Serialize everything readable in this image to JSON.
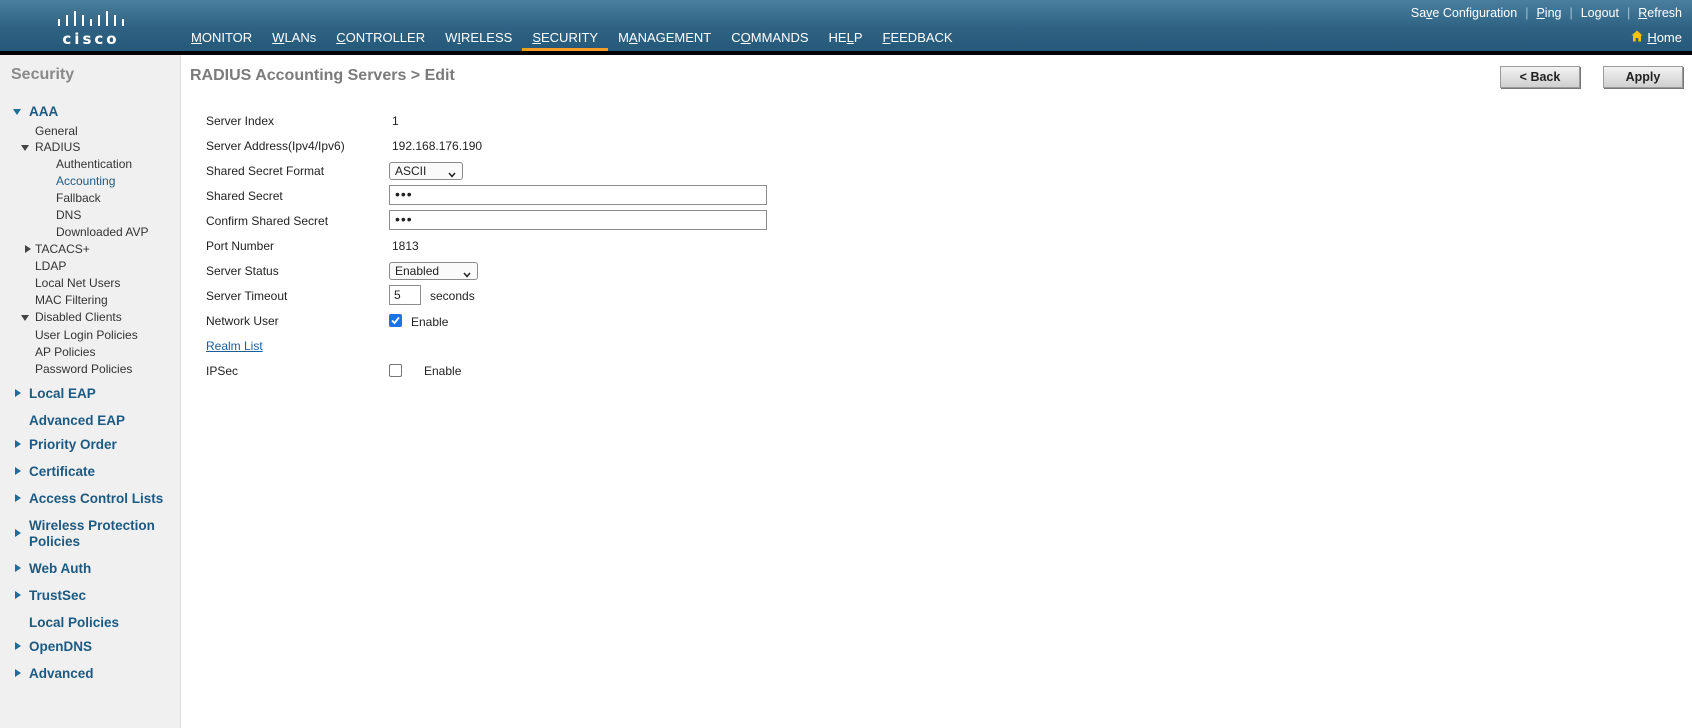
{
  "brand": {
    "logo_text": "cisco"
  },
  "header": {
    "nav": [
      {
        "label": "MONITOR",
        "key": "M",
        "rest": "ONITOR",
        "active": false
      },
      {
        "label": "WLANs",
        "key": "W",
        "rest": "LANs",
        "active": false
      },
      {
        "label": "CONTROLLER",
        "key": "C",
        "rest": "ONTROLLER",
        "active": false
      },
      {
        "label": "WIRELESS",
        "key": "I",
        "pre": "W",
        "rest": "RELESS",
        "active": false
      },
      {
        "label": "SECURITY",
        "key": "S",
        "rest": "ECURITY",
        "active": true
      },
      {
        "label": "MANAGEMENT",
        "key": "A",
        "pre": "M",
        "rest": "NAGEMENT",
        "active": false
      },
      {
        "label": "COMMANDS",
        "key": "O",
        "pre": "C",
        "rest": "MMANDS",
        "active": false
      },
      {
        "label": "HELP",
        "key": "L",
        "pre": "HE",
        "rest": "P",
        "active": false
      },
      {
        "label": "FEEDBACK",
        "key": "F",
        "rest": "EEDBACK",
        "active": false
      }
    ],
    "links": {
      "save_pre": "Sa",
      "save_key": "v",
      "save_rest": "e Configuration",
      "ping_key": "P",
      "ping_rest": "ing",
      "logout_pre": "Logout",
      "refresh_key": "R",
      "refresh_rest": "efresh",
      "separator": "|"
    },
    "home_key": "H",
    "home_rest": "ome"
  },
  "sidebar": {
    "title": "Security",
    "aaa": "AAA",
    "general": "General",
    "radius": "RADIUS",
    "authentication": "Authentication",
    "accounting": "Accounting",
    "fallback": "Fallback",
    "dns": "DNS",
    "downloaded_avp": "Downloaded AVP",
    "tacacs": "TACACS+",
    "ldap": "LDAP",
    "local_net_users": "Local Net Users",
    "mac_filtering": "MAC Filtering",
    "disabled_clients": "Disabled Clients",
    "user_login_policies": "User Login Policies",
    "ap_policies": "AP Policies",
    "password_policies": "Password Policies",
    "local_eap": "Local EAP",
    "advanced_eap": "Advanced EAP",
    "priority_order": "Priority Order",
    "certificate": "Certificate",
    "acl": "Access Control Lists",
    "wpp_line1": "Wireless Protection",
    "wpp_line2": "Policies",
    "web_auth": "Web Auth",
    "trustsec": "TrustSec",
    "local_policies": "Local Policies",
    "opendns": "OpenDNS",
    "advanced": "Advanced"
  },
  "main": {
    "title": "RADIUS Accounting Servers > Edit",
    "back_button": "< Back",
    "apply_button": "Apply",
    "fields": {
      "server_index_label": "Server Index",
      "server_index_value": "1",
      "server_address_label": "Server Address(Ipv4/Ipv6)",
      "server_address_value": "192.168.176.190",
      "secret_format_label": "Shared Secret Format",
      "secret_format_value": "ASCII",
      "shared_secret_label": "Shared Secret",
      "shared_secret_value": "•••",
      "confirm_secret_label": "Confirm Shared Secret",
      "confirm_secret_value": "•••",
      "port_label": "Port Number",
      "port_value": "1813",
      "status_label": "Server Status",
      "status_value": "Enabled",
      "timeout_label": "Server Timeout",
      "timeout_value": "5",
      "timeout_unit": "seconds",
      "network_user_label": "Network User",
      "network_user_enable": "Enable",
      "network_user_checked": true,
      "realm_list": "Realm List",
      "ipsec_label": "IPSec",
      "ipsec_enable": "Enable",
      "ipsec_checked": false
    }
  },
  "colors": {
    "header_blue": "#2f6283",
    "active_tab": "#f39c27",
    "sidebar_link": "#1d5a82",
    "checkbox": "#1a73e8"
  }
}
